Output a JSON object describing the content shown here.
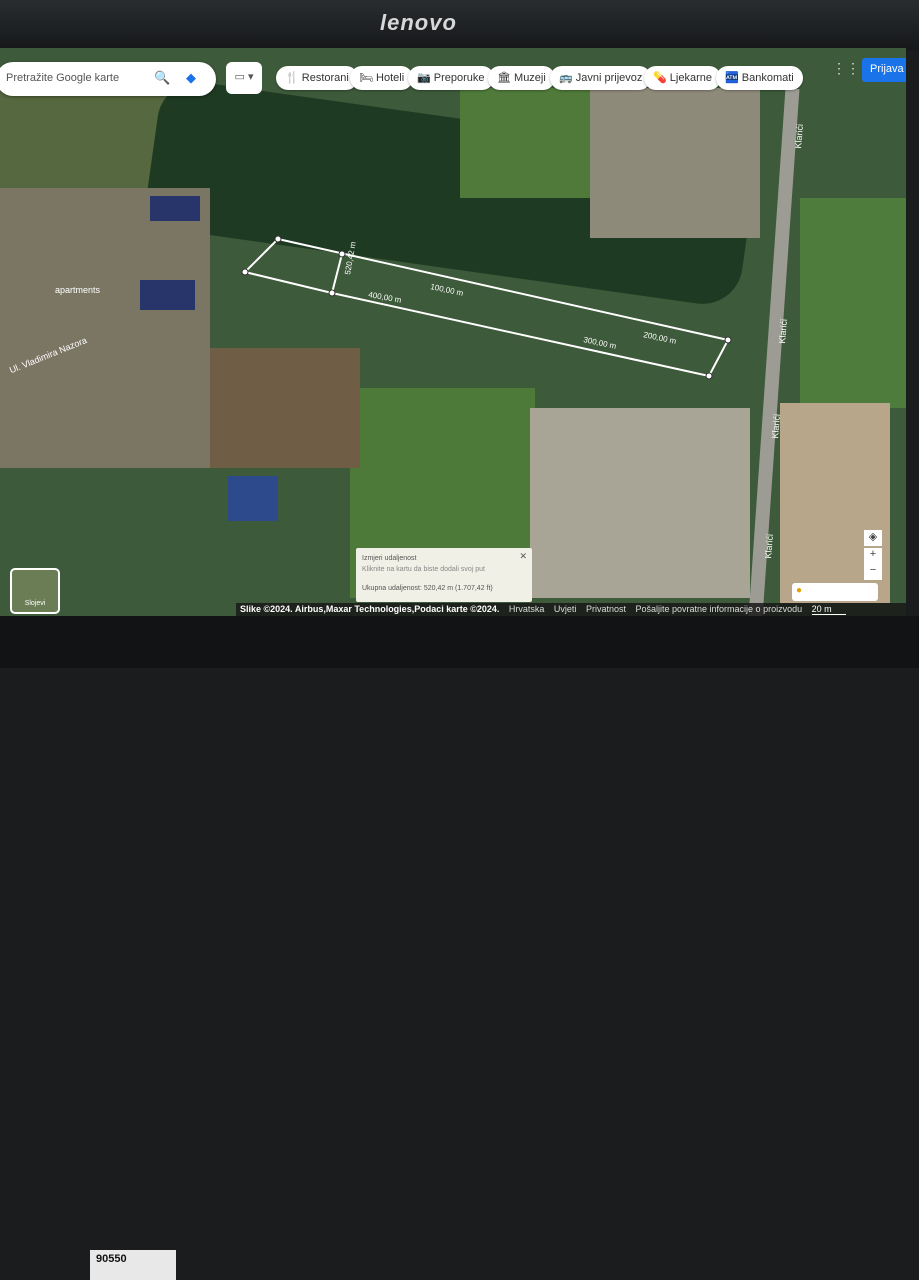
{
  "monitor": {
    "brand": "lenovo",
    "sticker": "90550"
  },
  "search": {
    "placeholder": "Pretražite Google karte"
  },
  "layers": "▭ ▾",
  "chips": [
    {
      "icon": "🍴",
      "label": "Restorani"
    },
    {
      "icon": "🛏",
      "label": "Hoteli"
    },
    {
      "icon": "📷",
      "label": "Preporuke"
    },
    {
      "icon": "🏛",
      "label": "Muzeji"
    },
    {
      "icon": "🚌",
      "label": "Javni prijevoz"
    },
    {
      "icon": "💊",
      "label": "Ljekarne"
    },
    {
      "icon": "🏧",
      "label": "Bankomati"
    }
  ],
  "signin": "Prijava",
  "map_labels": {
    "apartments": "apartments",
    "street": "Ul. Vladimira Nazora",
    "road1": "Klarići",
    "road2": "Klarići",
    "road3": "Klarići",
    "road4": "Klarići"
  },
  "measure_labels": [
    "520,42 m",
    "400,00 m",
    "100,00 m",
    "300,00 m",
    "200,00 m"
  ],
  "popup": {
    "title": "Izmjeri udaljenost",
    "hint": "Kliknite na kartu da biste dodali svoj put",
    "total": "Ukupna udaljenost: 520,42 m (1.707,42 ft)",
    "close": "✕"
  },
  "footer": {
    "attribution": "Slike ©2024. Airbus,Maxar Technologies,Podaci karte ©2024.",
    "links": [
      "Hrvatska",
      "Uvjeti",
      "Privatnost",
      "Pošaljite povratne informacije o proizvodu"
    ],
    "scale": "20 m"
  },
  "thumb": "Slojevi",
  "controls": {
    "compass": "◈",
    "zoom_in": "+",
    "zoom_out": "−"
  }
}
